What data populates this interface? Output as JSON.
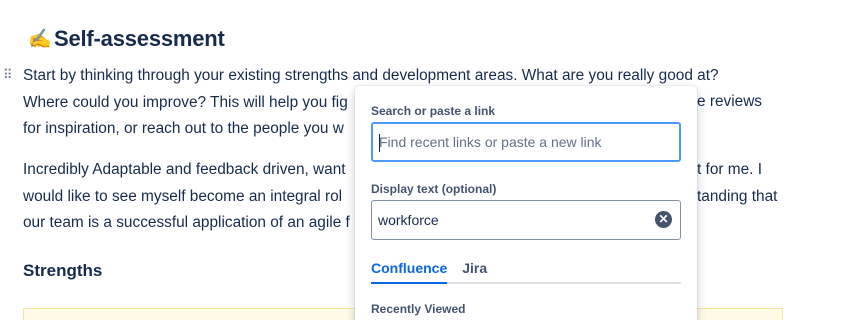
{
  "page": {
    "heading_emoji": "✍️",
    "heading": "Self-assessment",
    "para1_lines": [
      "Start by thinking through your existing strengths and development areas. What are you really good at?",
      "Where could you improve? This will help you fig",
      "for inspiration, or reach out to the people you w"
    ],
    "para1_right_fragments": [
      "e reviews"
    ],
    "para2_lines": [
      "Incredibly Adaptable and feedback driven, want",
      "would like to see myself become an integral rol",
      "our team is a successful application of an agile f"
    ],
    "para2_right_fragments": [
      "t for me. I",
      "tanding that"
    ],
    "subheading": "Strengths"
  },
  "link_popup": {
    "search_label": "Search or paste a link",
    "search_placeholder": "Find recent links or paste a new link",
    "search_value": "",
    "display_label": "Display text (optional)",
    "display_value": "workforce",
    "clear_icon": "✕",
    "tabs": [
      {
        "label": "Confluence",
        "active": true
      },
      {
        "label": "Jira",
        "active": false
      }
    ],
    "recent_label": "Recently Viewed"
  },
  "colors": {
    "accent": "#0c66e4",
    "focus_border": "#4c9aff",
    "panel_bg": "#fffae6"
  }
}
